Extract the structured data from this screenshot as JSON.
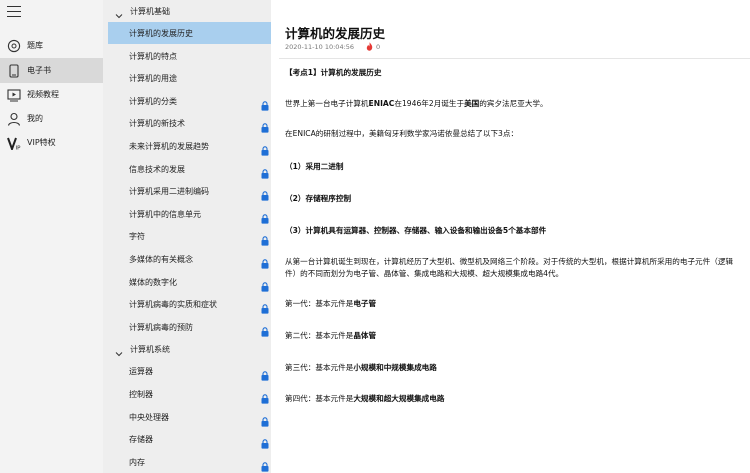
{
  "nav": {
    "items": [
      {
        "label": "题库",
        "icon": "question-bank-icon"
      },
      {
        "label": "电子书",
        "icon": "ebook-icon"
      },
      {
        "label": "视频教程",
        "icon": "video-icon"
      },
      {
        "label": "我的",
        "icon": "person-icon"
      },
      {
        "label": "VIP特权",
        "icon": "vip-icon"
      }
    ],
    "active_index": 1
  },
  "sections": [
    {
      "title": "计算机基础",
      "items": [
        {
          "label": "计算机的发展历史",
          "locked": false,
          "active": true
        },
        {
          "label": "计算机的特点",
          "locked": false
        },
        {
          "label": "计算机的用途",
          "locked": false
        },
        {
          "label": "计算机的分类",
          "locked": true
        },
        {
          "label": "计算机的新技术",
          "locked": true
        },
        {
          "label": "未来计算机的发展趋势",
          "locked": true
        },
        {
          "label": "信息技术的发展",
          "locked": true
        },
        {
          "label": "计算机采用二进制编码",
          "locked": true
        },
        {
          "label": "计算机中的信息单元",
          "locked": true
        },
        {
          "label": "字符",
          "locked": true
        },
        {
          "label": "多媒体的有关概念",
          "locked": true
        },
        {
          "label": "媒体的数字化",
          "locked": true
        },
        {
          "label": "计算机病毒的实质和症状",
          "locked": true
        },
        {
          "label": "计算机病毒的预防",
          "locked": true
        }
      ]
    },
    {
      "title": "计算机系统",
      "items": [
        {
          "label": "运算器",
          "locked": true
        },
        {
          "label": "控制器",
          "locked": true
        },
        {
          "label": "中央处理器",
          "locked": true
        },
        {
          "label": "存储器",
          "locked": true
        },
        {
          "label": "内存",
          "locked": true
        }
      ]
    }
  ],
  "article": {
    "title": "计算机的发展历史",
    "date": "2020-11-10 10:04:56",
    "views": "0",
    "paragraphs": [
      {
        "parts": [
          {
            "t": "【考点1】计算机的发展历史",
            "b": true
          }
        ]
      },
      {
        "parts": [
          {
            "t": "世界上第一台电子计算机"
          },
          {
            "t": "ENIAC",
            "b": true
          },
          {
            "t": "在1946年2月诞生于"
          },
          {
            "t": "美国",
            "b": true
          },
          {
            "t": "的宾夕法尼亚大学。"
          }
        ]
      },
      {
        "parts": [
          {
            "t": "在ENICA的研制过程中，美籍匈牙利数学家冯诺依曼总结了以下3点："
          }
        ]
      },
      {
        "parts": [
          {
            "t": "（1）采用二进制",
            "b": true
          }
        ]
      },
      {
        "parts": [
          {
            "t": "（2）存储程序控制",
            "b": true
          }
        ]
      },
      {
        "parts": [
          {
            "t": "（3）计算机具有运算器、控制器、存储器、输入设备和输出设备5个基本部件",
            "b": true
          }
        ]
      },
      {
        "parts": [
          {
            "t": "从第一台计算机诞生到现在，计算机经历了大型机、微型机及网络三个阶段。对于传统的大型机，根据计算机所采用的电子元件（逻辑"
          }
        ]
      },
      {
        "parts": [
          {
            "t": "件）的不同而划分为电子管、晶体管、集成电路和大规模、超大规模集成电路4代。"
          }
        ]
      },
      {
        "parts": [
          {
            "t": "第一代：基本元件是"
          },
          {
            "t": "电子管",
            "b": true
          }
        ]
      },
      {
        "parts": [
          {
            "t": "第二代：基本元件是"
          },
          {
            "t": "晶体管",
            "b": true
          }
        ]
      },
      {
        "parts": [
          {
            "t": "第三代：基本元件是"
          },
          {
            "t": "小规模和中规模集成电路",
            "b": true
          }
        ]
      },
      {
        "parts": [
          {
            "t": "第四代：基本元件是"
          },
          {
            "t": "大规模和超大规模集成电路",
            "b": true
          }
        ]
      }
    ]
  },
  "colors": {
    "nav_bg": "#f3f3f3",
    "list_bg": "#eeeeee",
    "active_row": "#a9cfee",
    "lock": "#1f6fd6",
    "fire": "#e53935"
  }
}
